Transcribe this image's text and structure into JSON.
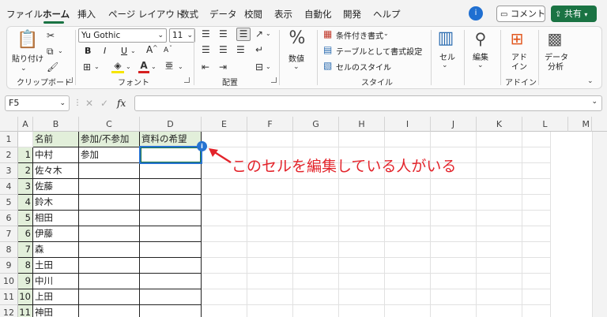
{
  "menu": {
    "tabs": [
      "ファイル",
      "ホーム",
      "挿入",
      "ページ レイアウト",
      "数式",
      "データ",
      "校閲",
      "表示",
      "自動化",
      "開発",
      "ヘルプ"
    ],
    "avatar_initial": "i",
    "comment_label": "コメント",
    "share_label": "共有"
  },
  "ribbon": {
    "clipboard": {
      "paste_label": "貼り付け",
      "group_label": "クリップボード"
    },
    "font": {
      "font_name": "Yu Gothic",
      "font_size": "11",
      "bold": "B",
      "italic": "I",
      "underline": "U",
      "grow": "A",
      "shrink": "A",
      "group_label": "フォント"
    },
    "alignment": {
      "group_label": "配置"
    },
    "number": {
      "label": "数値"
    },
    "styles": {
      "conditional": "条件付き書式",
      "table": "テーブルとして書式設定",
      "cell_style": "セルのスタイル",
      "group_label": "スタイル"
    },
    "cells": {
      "label": "セル"
    },
    "editing": {
      "label": "編集"
    },
    "addins": {
      "label1": "アド",
      "label2": "イン",
      "group_label": "アドイン"
    },
    "analysis": {
      "label1": "データ",
      "label2": "分析"
    }
  },
  "formula_bar": {
    "name_box": "F5",
    "fx": "fx",
    "value": ""
  },
  "grid": {
    "columns": [
      "A",
      "B",
      "C",
      "D",
      "E",
      "F",
      "G",
      "H",
      "I",
      "J",
      "K",
      "L",
      "M"
    ],
    "rows": [
      "1",
      "2",
      "3",
      "4",
      "5",
      "6",
      "7",
      "8",
      "9",
      "10",
      "11",
      "12"
    ],
    "headers": {
      "name": "名前",
      "attend": "参加/不参加",
      "material": "資料の希望"
    },
    "data": [
      {
        "no": "1",
        "name": "中村",
        "attend": "参加"
      },
      {
        "no": "2",
        "name": "佐々木",
        "attend": ""
      },
      {
        "no": "3",
        "name": "佐藤",
        "attend": ""
      },
      {
        "no": "4",
        "name": "鈴木",
        "attend": ""
      },
      {
        "no": "5",
        "name": "相田",
        "attend": ""
      },
      {
        "no": "6",
        "name": "伊藤",
        "attend": ""
      },
      {
        "no": "7",
        "name": "森",
        "attend": ""
      },
      {
        "no": "8",
        "name": "土田",
        "attend": ""
      },
      {
        "no": "9",
        "name": "中川",
        "attend": ""
      },
      {
        "no": "10",
        "name": "上田",
        "attend": ""
      },
      {
        "no": "11",
        "name": "神田",
        "attend": ""
      }
    ],
    "presence_initial": "i"
  },
  "annotation": "このセルを編集している人がいる",
  "colors": {
    "excel_green": "#1a7343",
    "coauthor_blue": "#2673d1",
    "annotation_red": "#e3242b",
    "header_fill": "#e2efda"
  }
}
